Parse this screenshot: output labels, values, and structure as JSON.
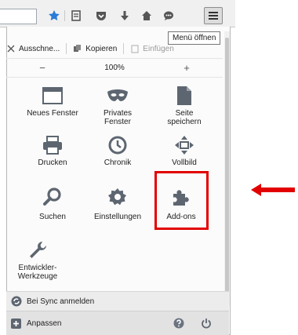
{
  "tooltip": "Menü öffnen",
  "edit": {
    "cut_label": "Ausschne...",
    "copy_label": "Kopieren",
    "paste_label": "Einfügen"
  },
  "zoom": {
    "minus": "−",
    "level": "100%",
    "plus": "+"
  },
  "tiles": {
    "new_window": "Neues Fenster",
    "private_window": "Privates\nFenster",
    "save_page": "Seite\nspeichern",
    "print": "Drucken",
    "history": "Chronik",
    "fullscreen": "Vollbild",
    "search": "Suchen",
    "settings": "Einstellungen",
    "addons": "Add-ons",
    "devtools": "Entwickler-\nWerkzeuge"
  },
  "footer": {
    "sync_label": "Bei Sync anmelden",
    "customize_label": "Anpassen"
  },
  "colors": {
    "highlight": "#e20000",
    "arrow": "#e20000",
    "bookmark_star": "#2b7bd8"
  }
}
